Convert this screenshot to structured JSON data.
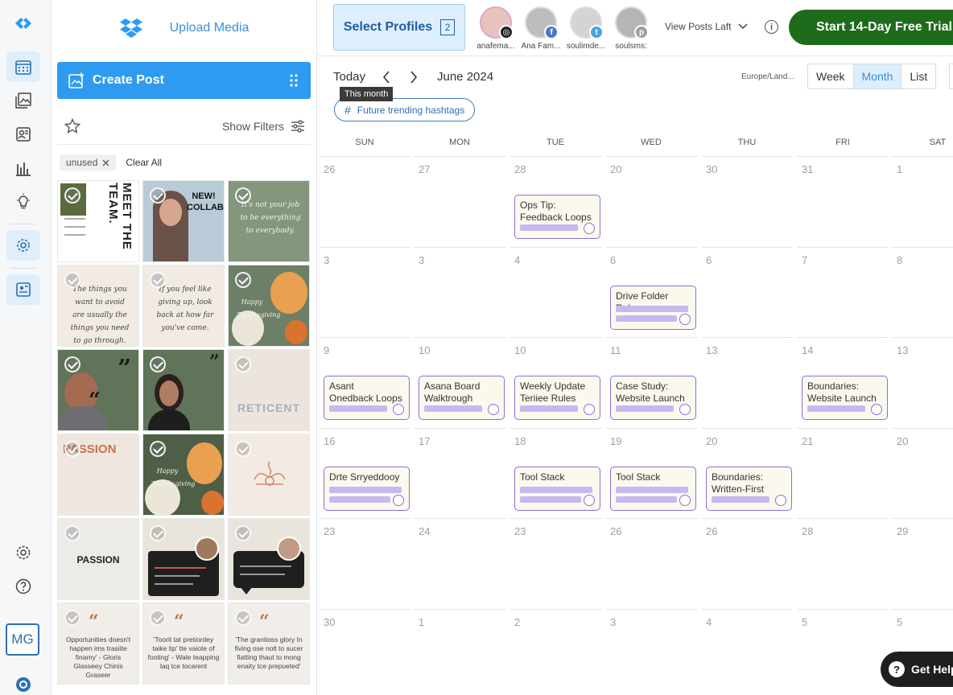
{
  "rail": {
    "user_initials": "MG"
  },
  "media": {
    "upload_label": "Upload Media",
    "create_post_label": "Create Post",
    "show_filters_label": "Show Filters",
    "chip_label": "unused",
    "clear_all_label": "Clear All",
    "tiles": [
      {
        "text": "MEET THE TEAM."
      },
      {
        "text": "NEW! COLLAB"
      },
      {
        "text": "It's not your job to be everything to everybody."
      },
      {
        "text": "The things you want to avoid are usually the things you need to go through."
      },
      {
        "text": "If you feel like giving up, look back at how far you've come."
      },
      {
        "text": "Happy Thanksgiving"
      },
      {
        "text": ""
      },
      {
        "text": ""
      },
      {
        "text": "RETICENT"
      },
      {
        "text": "PASSION"
      },
      {
        "text": "Happy Thanksgiving"
      },
      {
        "text": ""
      },
      {
        "text": "PASSION"
      },
      {
        "text": ""
      },
      {
        "text": ""
      },
      {
        "text": "Opportunities doesn't happen ims trasiite finamy' - Gloris Glasseey Chinis Graseer"
      },
      {
        "text": "'Toorit tat pretiordey taike tip' tte vaiote of footing' - Wale teapping laq tce tocarent"
      },
      {
        "text": "'The grantioss glory In fiving ose nolt to sucer fiatting thaut to mong enaity tce prepueted'"
      }
    ]
  },
  "topbar": {
    "select_profiles_label": "Select Profiles",
    "select_profiles_count": "2",
    "profiles": [
      {
        "name": "anafema...",
        "network": "instagram",
        "color": "#222"
      },
      {
        "name": "Ana Fam...",
        "network": "facebook",
        "color": "#4a78c9"
      },
      {
        "name": "soulimde...",
        "network": "twitter",
        "color": "#4aa3e0"
      },
      {
        "name": "soulsms:",
        "network": "pinterest",
        "color": "#9aa0a6"
      }
    ],
    "view_posts_label": "View Posts Laft",
    "trial_label": "Start 14-Day Free Trial"
  },
  "calendar": {
    "today_label": "Today",
    "month_label": "June 2024",
    "tooltip": "This month",
    "hashtags_label": "Future trending hashtags",
    "timezone": "Europe/Land...",
    "views": [
      "Week",
      "Month",
      "List"
    ],
    "active_view": "Month",
    "weekdays": [
      "SUN",
      "MON",
      "TUE",
      "WED",
      "THU",
      "FRI",
      "SAT"
    ],
    "weeks": [
      [
        "26",
        "27",
        "28",
        "20",
        "30",
        "31",
        "1"
      ],
      [
        "3",
        "3",
        "4",
        "6",
        "6",
        "7",
        "8"
      ],
      [
        "9",
        "10",
        "10",
        "11",
        "13",
        "14",
        "13"
      ],
      [
        "16",
        "17",
        "18",
        "19",
        "20",
        "21",
        "20"
      ],
      [
        "23",
        "24",
        "23",
        "26",
        "26",
        "28",
        "29"
      ],
      [
        "30",
        "1",
        "2",
        "3",
        "4",
        "5",
        "5"
      ]
    ],
    "events": [
      {
        "week": 0,
        "day": 2,
        "title": "Ops Tip:\nFeedback Loops"
      },
      {
        "week": 1,
        "day": 3,
        "title": "Drive Folder Rules"
      },
      {
        "week": 2,
        "day": 0,
        "title": "Asant\nOnedback Loops"
      },
      {
        "week": 2,
        "day": 1,
        "title": "Asana Board\nWalktrough"
      },
      {
        "week": 2,
        "day": 2,
        "title": "Weekly Update\nTeriiee Rules"
      },
      {
        "week": 2,
        "day": 3,
        "title": "Case Study:\nWebsite Launch"
      },
      {
        "week": 2,
        "day": 5,
        "title": "Boundaries:\nWebsite Launch"
      },
      {
        "week": 3,
        "day": 0,
        "title": "Drte Srryeddooy"
      },
      {
        "week": 3,
        "day": 2,
        "title": "Tool Stack"
      },
      {
        "week": 3,
        "day": 3,
        "title": "Tool Stack"
      },
      {
        "week": 3,
        "day": 4,
        "title": "Boundaries:\nWritten-First"
      }
    ]
  },
  "help_label": "Get Help"
}
